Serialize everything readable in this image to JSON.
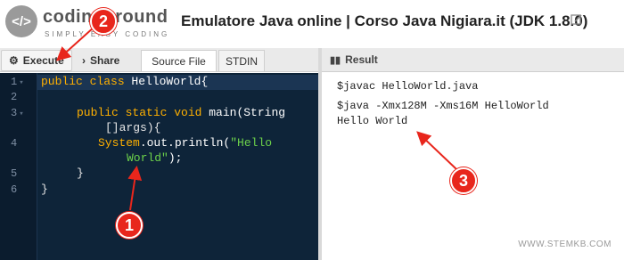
{
  "header": {
    "logo_name": "codingground",
    "logo_tagline": "SIMPLY EASY CODING",
    "title": "Emulatore Java online | Corso Java Nigiara.it (JDK 1.8.0)"
  },
  "toolbar": {
    "execute_label": "Execute",
    "share_label": "Share",
    "tabs": [
      "Source File",
      "STDIN"
    ]
  },
  "editor": {
    "line_numbers": [
      "1",
      "2",
      "3",
      "",
      "4",
      "",
      "5",
      "6"
    ],
    "code": {
      "l1_kw": "public class",
      "l1_rest": " HelloWorld{",
      "l3_kw": "public static void",
      "l3_rest": " main(String",
      "l3b": "[]args){",
      "l4_sys": "System",
      "l4_mid": ".out.println(",
      "l4_str1": "\"Hello",
      "l4_str2": "World\"",
      "l4_end": ");",
      "l5": "}",
      "l6": "}"
    }
  },
  "result": {
    "title": "Result",
    "lines": [
      "$javac HelloWorld.java",
      "$java -Xmx128M -Xms16M HelloWorld",
      "Hello World"
    ]
  },
  "annotations": {
    "badge1": "1",
    "badge2": "2",
    "badge3": "3"
  },
  "watermark": "WWW.STEMKB.COM",
  "colors": {
    "editor_bg": "#0e2439",
    "badge_red": "#e8261c",
    "keyword": "#ffb000",
    "string": "#6dd24a"
  }
}
